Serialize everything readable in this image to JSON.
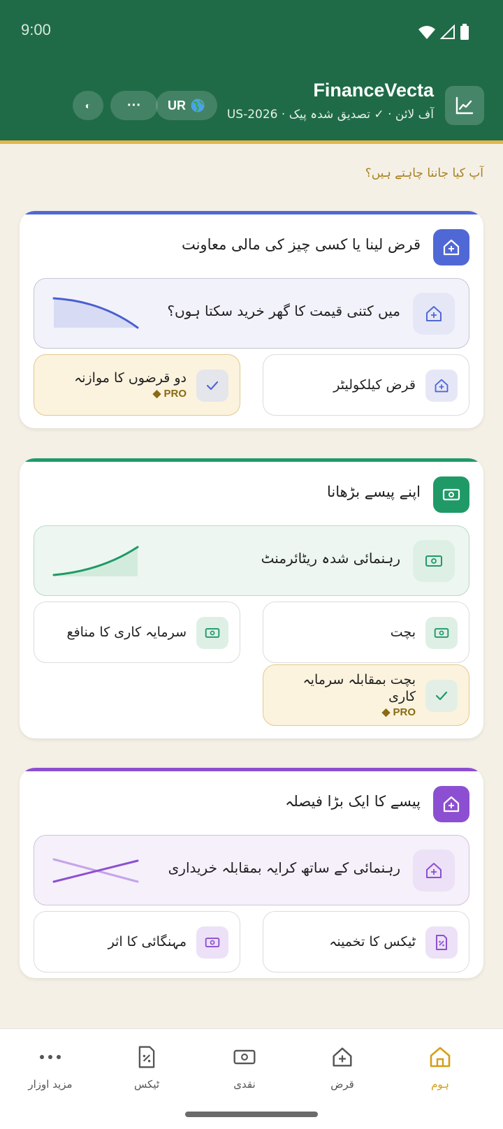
{
  "status_bar": {
    "time": "9:00"
  },
  "header": {
    "app_name": "FinanceVecta",
    "subtitle": "آف لائن · ✓ تصدیق شدہ پیک · US-2026",
    "lang_button": "UR",
    "more_button": "···",
    "theme_button": "◐"
  },
  "prompt": "آپ کیا جاننا چاہتے ہیں؟",
  "sections": [
    {
      "title": "قرض لینا یا کسی چیز کی مالی معاونت",
      "accent": "#5068d6",
      "feature": "میں کتنی قیمت کا گھر خرید سکتا ہوں؟",
      "tiles": [
        {
          "label": "قرض کیلکولیٹر",
          "pro": ""
        },
        {
          "label": "دو قرضوں کا موازنہ",
          "pro": "PRO ◆"
        }
      ]
    },
    {
      "title": "اپنے پیسے بڑھانا",
      "accent": "#1f9a67",
      "feature": "رہنمائی شدہ ریٹائرمنٹ",
      "tiles": [
        {
          "label": "بچت",
          "pro": ""
        },
        {
          "label": "سرمایہ کاری کا منافع",
          "pro": ""
        },
        {
          "label": "بچت بمقابلہ سرمایہ کاری",
          "pro": "PRO ◆"
        }
      ]
    },
    {
      "title": "پیسے کا ایک بڑا فیصلہ",
      "accent": "#8d4fd1",
      "feature": "رہنمائی کے ساتھ کرایہ بمقابلہ خریداری",
      "tiles": [
        {
          "label": "ٹیکس کا تخمینہ",
          "pro": ""
        },
        {
          "label": "مہنگائی کا اثر",
          "pro": ""
        }
      ]
    }
  ],
  "nav": [
    {
      "label": "ہوم",
      "icon": "home-icon",
      "active": true
    },
    {
      "label": "قرض",
      "icon": "house-loan-icon",
      "active": false
    },
    {
      "label": "نقدی",
      "icon": "cash-icon",
      "active": false
    },
    {
      "label": "ٹیکس",
      "icon": "tax-doc-icon",
      "active": false
    },
    {
      "label": "مزید اوزار",
      "icon": "more-icon",
      "active": false
    }
  ],
  "colors": {
    "header_bg": "#1f6b47",
    "header_stripe": "#e3b64b",
    "active_nav": "#d69e16",
    "prompt": "#a7801f"
  }
}
